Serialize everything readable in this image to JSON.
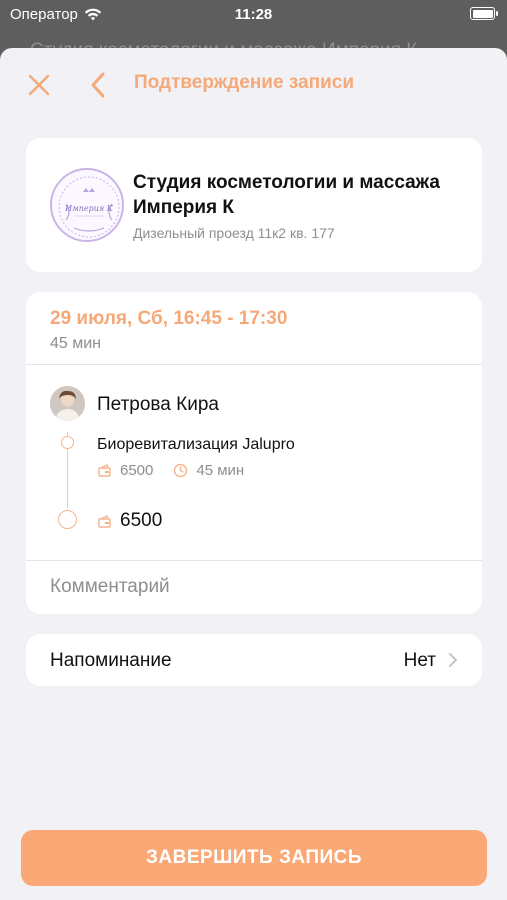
{
  "status_bar": {
    "carrier": "Оператор",
    "time": "11:28"
  },
  "background_title": "Студия косметологии и массажа Империя К",
  "header": {
    "title": "Подтверждение записи"
  },
  "salon": {
    "logo_text": "Империя К",
    "name": "Студия косметологии и массажа Империя К",
    "address": "Дизельный проезд 11к2 кв. 177"
  },
  "booking": {
    "datetime": "29 июля, Сб, 16:45 - 17:30",
    "duration": "45 мин",
    "master": {
      "name": "Петрова Кира"
    },
    "services": [
      {
        "name": "Биоревитализация  Jalupro",
        "price": "6500",
        "duration": "45 мин"
      }
    ],
    "total": "6500",
    "comment_placeholder": "Комментарий"
  },
  "reminder": {
    "label": "Напоминание",
    "value": "Нет"
  },
  "submit_label": "ЗАВЕРШИТЬ ЗАПИСЬ",
  "colors": {
    "accent": "#f5a878",
    "button": "#f9a876",
    "sheet_bg": "#f2f2f6",
    "card_bg": "#ffffff",
    "secondary_text": "#8e8e93"
  }
}
